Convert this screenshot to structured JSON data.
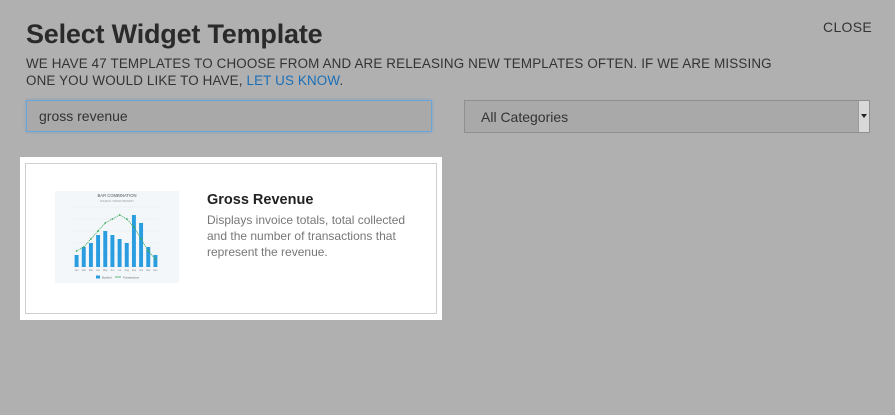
{
  "dialog": {
    "title": "Select Widget Template",
    "close_label": "CLOSE",
    "description": "WE HAVE 47 TEMPLATES TO CHOOSE FROM AND ARE RELEASING NEW TEMPLATES OFTEN. IF WE ARE MISSING ONE YOU WOULD LIKE TO HAVE, ",
    "link_label": "LET US KNOW",
    "description_end": "."
  },
  "search": {
    "value": "gross revenue"
  },
  "category_select": {
    "value": "All Categories"
  },
  "results": [
    {
      "title": "Gross Revenue",
      "description": "Displays invoice totals, total collected and the number of transactions that represent the revenue.",
      "thumbnail": {
        "chart_data": {
          "type": "bar",
          "title": "BAR COMBINATION",
          "subtitle": "SOURCE: WIDGETMONKEY",
          "categories": [
            "Jan",
            "Feb",
            "Mar",
            "Apr",
            "May",
            "Jun",
            "Jul",
            "Aug",
            "Sep",
            "Oct",
            "Nov",
            "Dec"
          ],
          "series": [
            {
              "name": "Booked",
              "type": "bar",
              "values": [
                3,
                5,
                6,
                8,
                9,
                8,
                7,
                6,
                13,
                11,
                5,
                3
              ]
            },
            {
              "name": "Transactions",
              "type": "line",
              "values": [
                4,
                5,
                7,
                9,
                11,
                12,
                13,
                12,
                10,
                7,
                4,
                2
              ]
            }
          ],
          "ylim": [
            0,
            15
          ],
          "bar_color": "#2a9de0",
          "line_color": "#3aa85a"
        }
      }
    }
  ]
}
